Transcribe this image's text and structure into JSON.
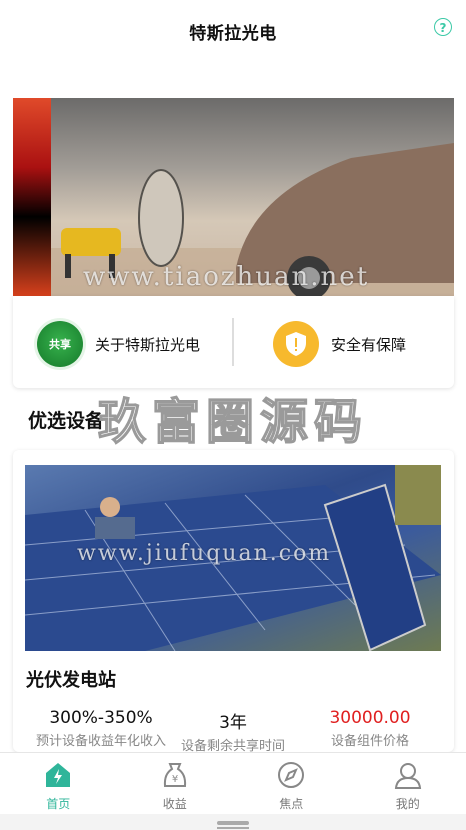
{
  "header": {
    "title": "特斯拉光电",
    "help_icon": "question-circle-icon"
  },
  "banner": {
    "watermark": "www.tiaozhuan.net"
  },
  "info": {
    "about_label": "关于特斯拉光电",
    "about_icon_text": "共享",
    "safety_label": "安全有保障",
    "safety_icon": "shield-icon"
  },
  "section": {
    "title": "优选设备",
    "overlay_watermark": "玖富圈源码"
  },
  "product": {
    "image_watermark": "www.jiufuquan.com",
    "name": "光伏发电站",
    "stats": [
      {
        "value": "300%-350%",
        "label": "预计设备收益年化收入"
      },
      {
        "value": "3年",
        "label": "设备剩余共享时间"
      },
      {
        "value": "30000.00",
        "label": "设备组件价格"
      }
    ]
  },
  "tabs": [
    {
      "label": "首页",
      "icon": "home-lightning-icon",
      "active": true
    },
    {
      "label": "收益",
      "icon": "yen-bag-icon",
      "active": false
    },
    {
      "label": "焦点",
      "icon": "compass-icon",
      "active": false
    },
    {
      "label": "我的",
      "icon": "user-icon",
      "active": false
    }
  ],
  "colors": {
    "accent": "#2fb59a",
    "price": "#e02020",
    "safety": "#f7b92d",
    "share": "#1f8a34"
  }
}
